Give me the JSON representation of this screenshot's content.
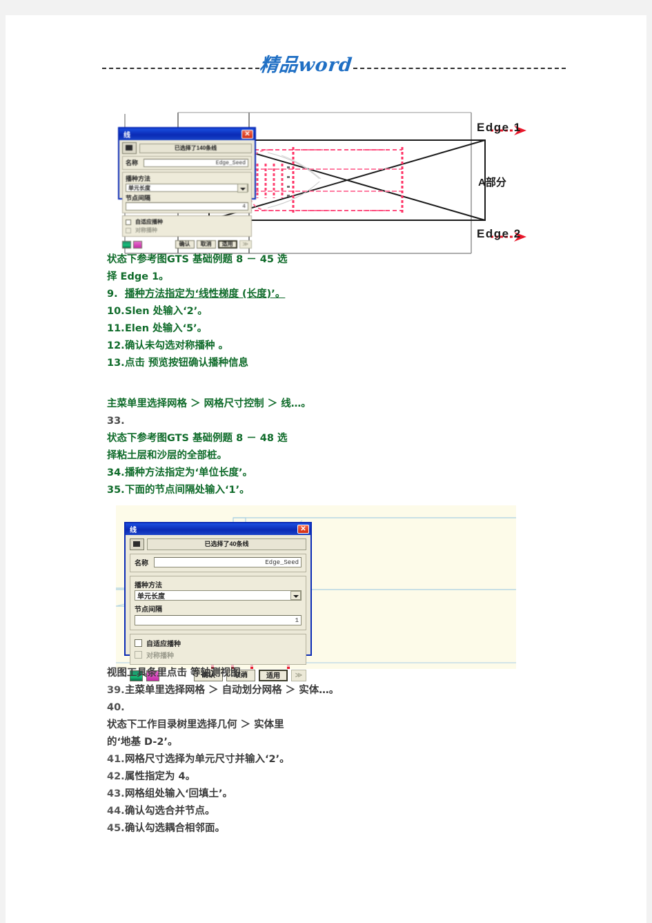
{
  "header": {
    "watermark": "精品word"
  },
  "figure_top": {
    "label_edge1": "Edge 1",
    "label_edge2": "Edge 2",
    "label_part_a": "A部分"
  },
  "dialog_small": {
    "title": "线",
    "selection_text": "已选择了140条线",
    "name_label": "名称",
    "name_value": "Edge_Seed",
    "method_label": "播种方法",
    "method_value": "单元长度",
    "interval_label": "节点间隔",
    "interval_value": "4",
    "auto_seed_label": "自适应播种",
    "sym_seed_label": "对称播种",
    "btn_ok": "确认",
    "btn_cancel": "取消",
    "btn_apply": "适用",
    "btn_more": "≫"
  },
  "dialog_large": {
    "title": "线",
    "selection_text": "已选择了40条线",
    "name_label": "名称",
    "name_value": "Edge_Seed",
    "method_label": "播种方法",
    "method_value": "单元长度",
    "interval_label": "节点间隔",
    "interval_value": "1",
    "auto_seed_label": "自适应播种",
    "sym_seed_label": "对称播种",
    "btn_ok": "确认",
    "btn_cancel": "取消",
    "btn_apply": "适用",
    "btn_more": "≫"
  },
  "block1": {
    "l1": "状态下参考图GTS  基础例题 8  －  45 选",
    "l2": "择 Edge 1。",
    "n9": "9.",
    "l9": "播种方法指定为‘线性梯度 (长度)’。",
    "n10": "10.",
    "l10": "Slen 处输入‘2’。",
    "n11": "11.",
    "l11": "Elen 处输入‘5’。",
    "n12": "12.",
    "l12": "确认未勾选对称播种 。",
    "n13": "13.",
    "l13": "点击  预览按钮确认播种信息"
  },
  "block2": {
    "l1": "主菜单里选择网格 ＞ 网格尺寸控制 ＞ 线…。",
    "n33": "33.",
    "l2": "状态下参考图GTS  基础例题 8  －  48 选",
    "l3": "择粘土层和沙层的全部桩。",
    "n34": "34.",
    "l34": "播种方法指定为‘单位长度’。",
    "n35": "35.",
    "l35": "下面的节点间隔处输入‘1’。"
  },
  "block3": {
    "l1": "视图工具条里点击    等轴测视图。",
    "n39": "39.",
    "l39": "主菜单里选择网格 ＞ 自动划分网格 ＞ 实体…。",
    "n40": "40.",
    "l40a": "状态下工作目录树里选择几何 ＞ 实体里",
    "l40b": "的‘地基 D-2’。",
    "n41": "41.",
    "l41": "网格尺寸选择为单元尺寸并输入‘2’。",
    "n42": "42.",
    "l42": "属性指定为 4。",
    "n43": "43.",
    "l43": "网格组处输入‘回填土’。",
    "n44": "44.",
    "l44": "确认勾选合并节点。",
    "n45": "45.",
    "l45": "确认勾选耦合相邻面。"
  },
  "colors": {
    "text_green": "#0f6b2a",
    "text_gray": "#4a4a4a",
    "watermark_blue": "#1f6fc4",
    "dialog_title_blue": "#0a2ab5",
    "seed_pink": "#ff4d7e",
    "cad_bg": "#fdfbe9",
    "cad_line": "#a9cfe3"
  }
}
